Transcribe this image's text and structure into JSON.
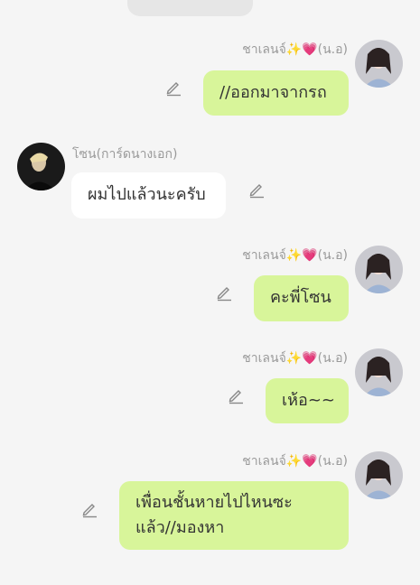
{
  "colors": {
    "background": "#f5f5f5",
    "own_bubble": "#d8f59a",
    "other_bubble": "#ffffff",
    "sender_name": "#9a9a9a"
  },
  "messages": [
    {
      "sender": "ชาเลนจ์✨💗(น.อ)",
      "text": "//ออกมาจากรถ",
      "side": "right"
    },
    {
      "sender": "โซน(การ์ดนางเอก)",
      "text": "ผมไปแล้วนะครับ",
      "side": "left"
    },
    {
      "sender": "ชาเลนจ์✨💗(น.อ)",
      "text": "คะพี่โซน",
      "side": "right"
    },
    {
      "sender": "ชาเลนจ์✨💗(น.อ)",
      "text": "เห้อ~~",
      "side": "right"
    },
    {
      "sender": "ชาเลนจ์✨💗(น.อ)",
      "text_lines": [
        "เพื่อนชั้นหายไปไหนซะ",
        "แล้ว//มองหา"
      ],
      "side": "right"
    }
  ],
  "icons": {
    "edit": "pencil-icon",
    "avatar_right": "avatar-girl",
    "avatar_left": "avatar-boy"
  }
}
